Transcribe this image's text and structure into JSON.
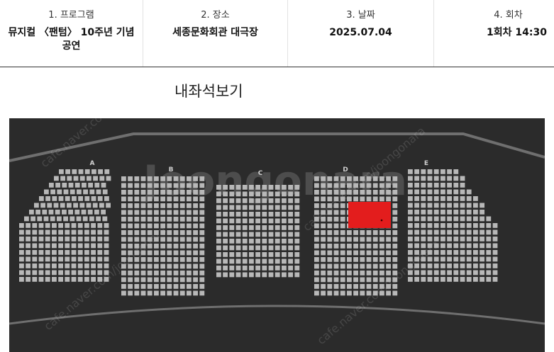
{
  "steps": [
    {
      "label": "1. 프로그램",
      "value": "뮤지컬 〈팬텀〉 10주년 기념 공연"
    },
    {
      "label": "2. 장소",
      "value": "세종문화회관 대극장"
    },
    {
      "label": "3. 날짜",
      "value": "2025.07.04"
    },
    {
      "label": "4. 회차",
      "value": "1회차 14:30"
    }
  ],
  "page_title": "내좌석보기",
  "seat_map": {
    "sections": [
      "A",
      "B",
      "C",
      "D",
      "E"
    ],
    "watermark": "Joongonara",
    "watermark_url": "cafe.naver.com/joongonara",
    "highlight_section": "D",
    "colors": {
      "background": "#2b2b2b",
      "seat": "#b8b8b8",
      "outline": "#6f6f6f",
      "highlight": "#e31d1d"
    }
  }
}
